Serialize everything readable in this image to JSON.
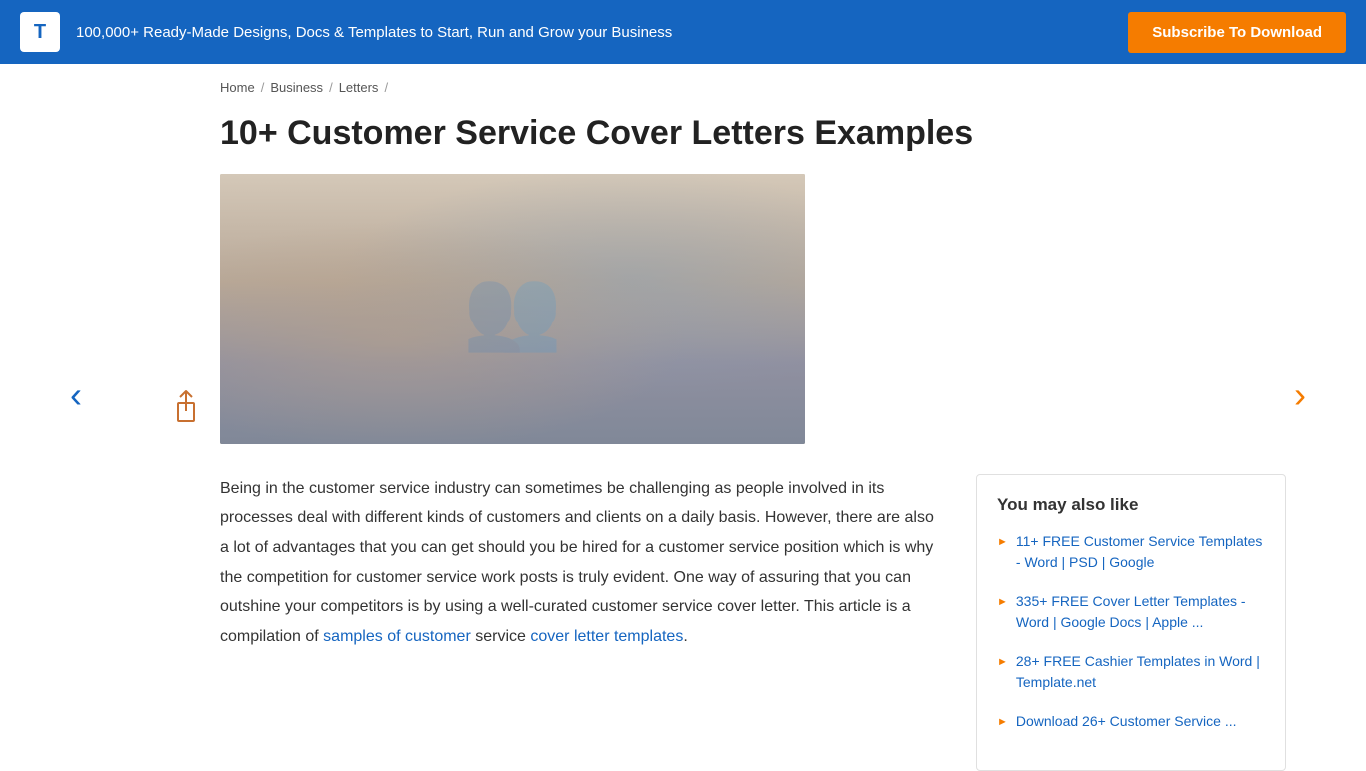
{
  "banner": {
    "logo": "T",
    "text": "100,000+ Ready-Made Designs, Docs & Templates to Start, Run and Grow your Business",
    "subscribe_label": "Subscribe To Download"
  },
  "breadcrumb": {
    "items": [
      "Home",
      "Business",
      "Letters"
    ]
  },
  "page": {
    "title": "10+ Customer Service Cover Letters Examples"
  },
  "main_text": {
    "paragraph": "Being in the customer service industry can sometimes be challenging as people involved in its processes deal with different kinds of customers and clients on a daily basis. However, there are also a lot of advantages that you can get should you be hired for a customer service position which is why the competition for customer service work posts is truly evident. One way of assuring that you can outshine your competitors is by using a well-curated customer service cover letter. This article is a compilation of",
    "link1_text": "samples of customer",
    "middle_text": "service",
    "link2_text": "cover letter templates",
    "end_text": "."
  },
  "sidebar": {
    "title": "You may also like",
    "items": [
      {
        "text": "11+ FREE Customer Service Templates - Word | PSD | Google"
      },
      {
        "text": "335+ FREE Cover Letter Templates - Word | Google Docs | Apple ..."
      },
      {
        "text": "28+ FREE Cashier Templates in Word | Template.net"
      },
      {
        "text": "Download 26+ Customer Service ..."
      }
    ]
  }
}
